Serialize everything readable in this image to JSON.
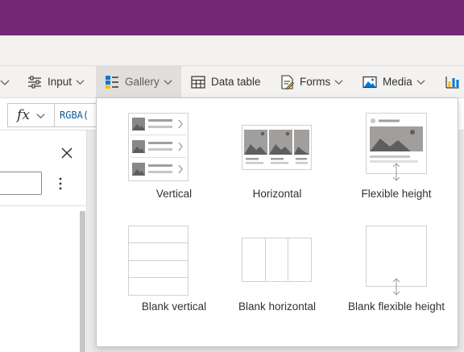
{
  "ribbon": {
    "input_label": "Input",
    "gallery_label": "Gallery",
    "data_table_label": "Data table",
    "forms_label": "Forms",
    "media_label": "Media"
  },
  "formula_bar": {
    "fx_label": "fx",
    "value": "RGBA("
  },
  "gallery_menu": {
    "items": [
      {
        "label": "Vertical"
      },
      {
        "label": "Horizontal"
      },
      {
        "label": "Flexible height"
      },
      {
        "label": "Blank vertical"
      },
      {
        "label": "Blank horizontal"
      },
      {
        "label": "Blank flexible height"
      }
    ]
  },
  "colors": {
    "title_bar": "#742774",
    "ribbon_bg": "#f3f2f1",
    "active_tab": "#e1dfdd",
    "thumb_gray": "#a19f9d",
    "thumb_dark": "#8a8886"
  }
}
